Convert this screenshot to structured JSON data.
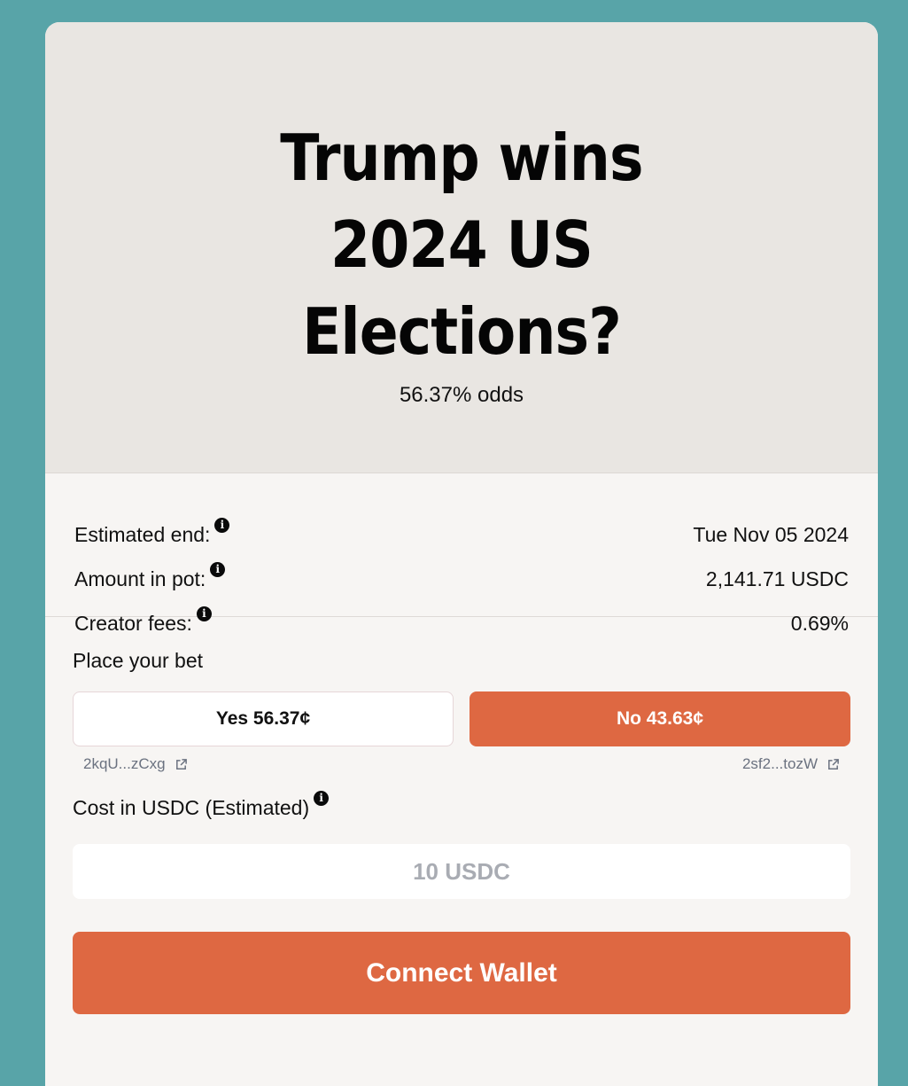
{
  "market": {
    "title": "Trump wins 2024 US Elections?",
    "odds_text": "56.37% odds"
  },
  "stats": [
    {
      "label": "Estimated end:",
      "value": "Tue Nov 05 2024",
      "icon": "info-icon"
    },
    {
      "label": "Amount in pot:",
      "value": "2,141.71 USDC",
      "icon": "info-icon"
    },
    {
      "label": "Creator fees:",
      "value": "0.69%",
      "icon": "info-icon"
    }
  ],
  "bet": {
    "heading": "Place your bet",
    "yes_label": "Yes 56.37¢",
    "no_label": "No 43.63¢",
    "yes_address": "2kqU...zCxg",
    "no_address": "2sf2...tozW",
    "cost_label": "Cost in USDC (Estimated)",
    "cost_placeholder": "10 USDC",
    "connect_label": "Connect Wallet"
  },
  "colors": {
    "background": "#58a4a8",
    "accent": "#de6842",
    "hero": "#e9e6e2",
    "card": "#f7f5f3"
  }
}
